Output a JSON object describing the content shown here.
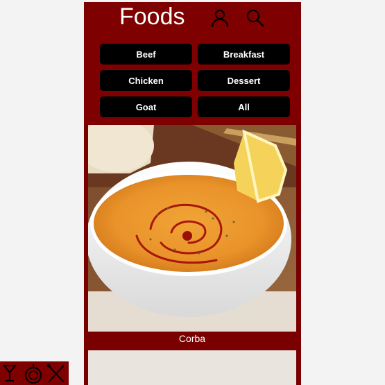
{
  "header": {
    "title": "Foods",
    "icons": [
      "user-icon",
      "search-icon"
    ]
  },
  "categories": [
    {
      "label": "Beef"
    },
    {
      "label": "Breakfast"
    },
    {
      "label": "Chicken"
    },
    {
      "label": "Dessert"
    },
    {
      "label": "Goat"
    },
    {
      "label": "All"
    }
  ],
  "meals": [
    {
      "name": "Corba",
      "icon": "soup-bowl-image"
    }
  ],
  "logo": {
    "icon": "restaurant-logo-icon"
  },
  "colors": {
    "header_bg": "#7e0000",
    "button_bg": "#000000",
    "text": "#ffffff"
  }
}
